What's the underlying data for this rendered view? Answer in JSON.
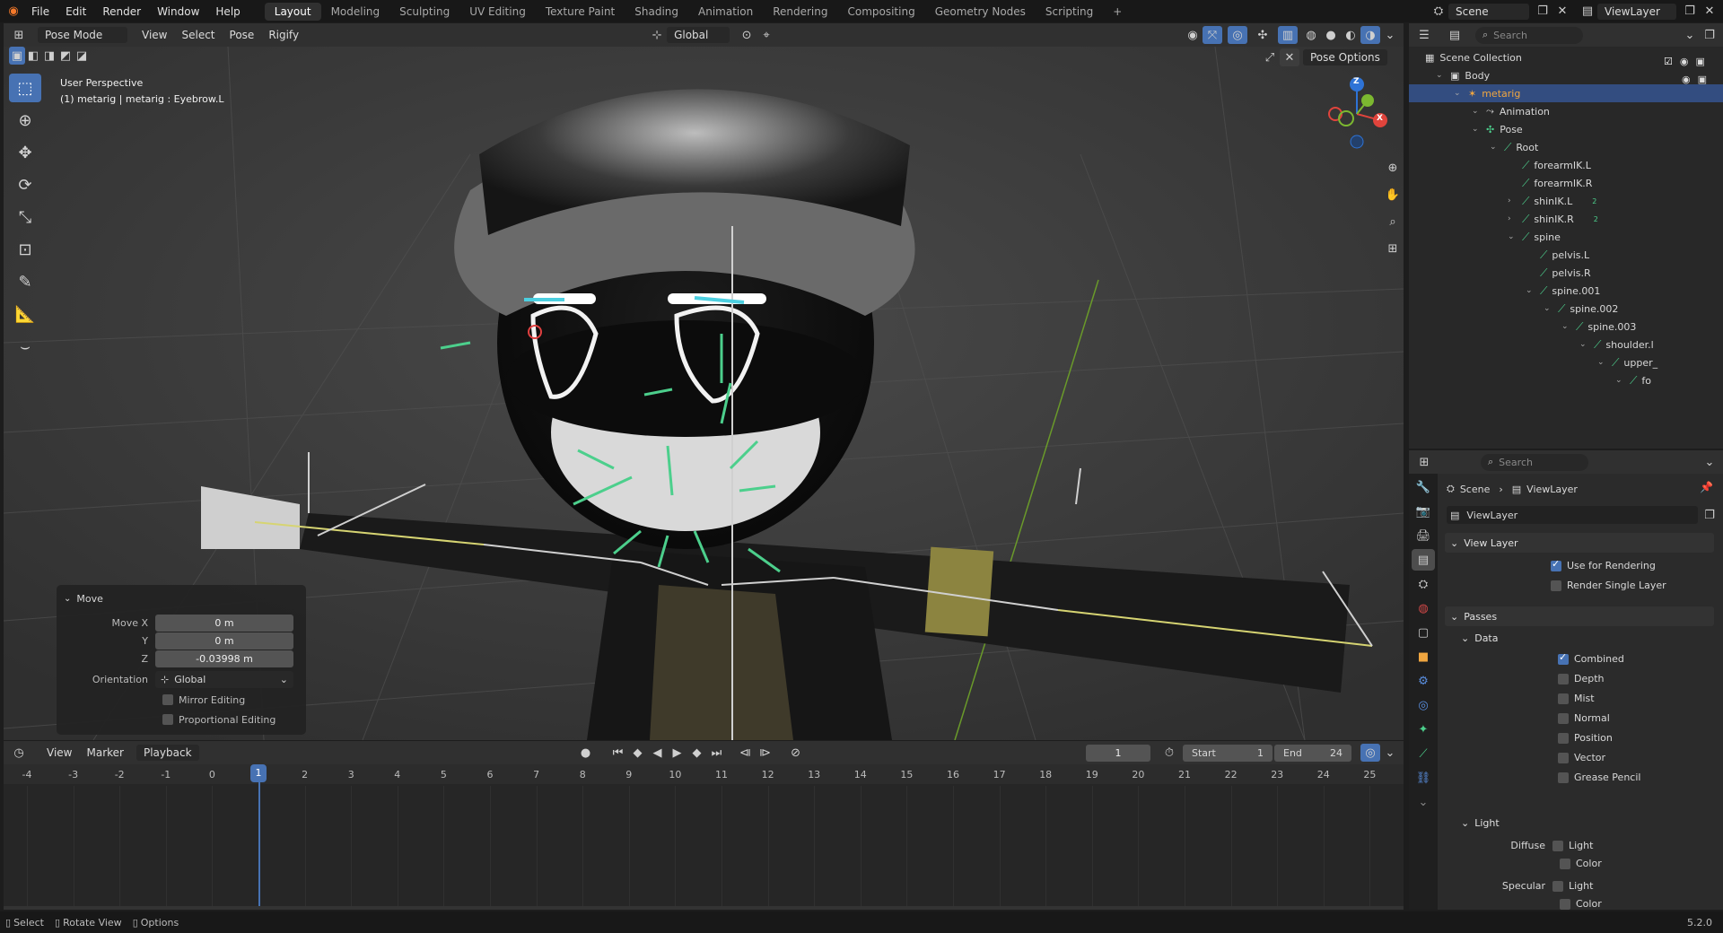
{
  "menubar": {
    "items": [
      "File",
      "Edit",
      "Render",
      "Window",
      "Help"
    ],
    "workspaces": [
      "Layout",
      "Modeling",
      "Sculpting",
      "UV Editing",
      "Texture Paint",
      "Shading",
      "Animation",
      "Rendering",
      "Compositing",
      "Geometry Nodes",
      "Scripting"
    ],
    "active_workspace": "Layout",
    "add_tab": "+",
    "scene_name": "Scene",
    "view_layer_name": "ViewLayer"
  },
  "viewport_header": {
    "mode": "Pose Mode",
    "menus": [
      "View",
      "Select",
      "Pose",
      "Rigify"
    ],
    "transform_orientation": "Global",
    "pose_options": "Pose Options"
  },
  "viewport": {
    "perspective_label": "User Perspective",
    "active_object_label": "(1) metarig | metarig : Eyebrow.L",
    "gizmo_axes": {
      "x": "X",
      "y": "Y",
      "z": "Z"
    }
  },
  "move_panel": {
    "title": "Move",
    "move_x_label": "Move X",
    "move_x": "0 m",
    "y_label": "Y",
    "y": "0 m",
    "z_label": "Z",
    "z": "-0.03998 m",
    "orientation_label": "Orientation",
    "orientation": "Global",
    "mirror_editing": "Mirror Editing",
    "proportional_editing": "Proportional Editing"
  },
  "timeline": {
    "menus": [
      "View",
      "Marker",
      "Playback"
    ],
    "current_frame": "1",
    "start_label": "Start",
    "start": "1",
    "end_label": "End",
    "end": "24",
    "frame_labels": [
      "-4",
      "-3",
      "-2",
      "-1",
      "0",
      "1",
      "2",
      "3",
      "4",
      "5",
      "6",
      "7",
      "8",
      "9",
      "10",
      "11",
      "12",
      "13",
      "14",
      "15",
      "16",
      "17",
      "18",
      "19",
      "20",
      "21",
      "22",
      "23",
      "24",
      "25"
    ],
    "playhead_frame": 1
  },
  "statusbar": {
    "select": "Select",
    "rotate_view": "Rotate View",
    "options": "Options",
    "version": "5.2.0"
  },
  "outliner": {
    "search_placeholder": "Search",
    "scene_collection": "Scene Collection",
    "rows": [
      {
        "label": "Body",
        "indent": 0
      },
      {
        "label": "metarig",
        "indent": 1
      },
      {
        "label": "Animation",
        "indent": 2
      },
      {
        "label": "Pose",
        "indent": 2
      },
      {
        "label": "Root",
        "indent": 3
      },
      {
        "label": "forearmIK.L",
        "indent": 4
      },
      {
        "label": "forearmIK.R",
        "indent": 4
      },
      {
        "label": "shinIK.L",
        "indent": 4
      },
      {
        "label": "shinIK.R",
        "indent": 4
      },
      {
        "label": "spine",
        "indent": 4
      },
      {
        "label": "pelvis.L",
        "indent": 5
      },
      {
        "label": "pelvis.R",
        "indent": 5
      },
      {
        "label": "spine.001",
        "indent": 5
      },
      {
        "label": "spine.002",
        "indent": 6
      },
      {
        "label": "spine.003",
        "indent": 7
      },
      {
        "label": "shoulder.l",
        "indent": 8
      },
      {
        "label": "upper_",
        "indent": 9
      },
      {
        "label": "fo",
        "indent": 10
      }
    ],
    "badge_2": "2"
  },
  "properties": {
    "search_placeholder": "Search",
    "breadcrumb_scene": "Scene",
    "breadcrumb_viewlayer": "ViewLayer",
    "view_layer_field": "ViewLayer",
    "view_layer_section": "View Layer",
    "use_for_rendering": "Use for Rendering",
    "render_single_layer": "Render Single Layer",
    "passes_section": "Passes",
    "data_section": "Data",
    "data_passes": [
      "Combined",
      "Depth",
      "Mist",
      "Normal",
      "Position",
      "Vector",
      "Grease Pencil"
    ],
    "light_section": "Light",
    "diffuse_label": "Diffuse",
    "specular_label": "Specular",
    "light_option": "Light",
    "color_option": "Color"
  },
  "colors": {
    "accent_blue": "#4772b3",
    "selected_bone": "#4ccfe0",
    "bone_green": "#4ccf8c",
    "active_orange": "#f0a640"
  }
}
